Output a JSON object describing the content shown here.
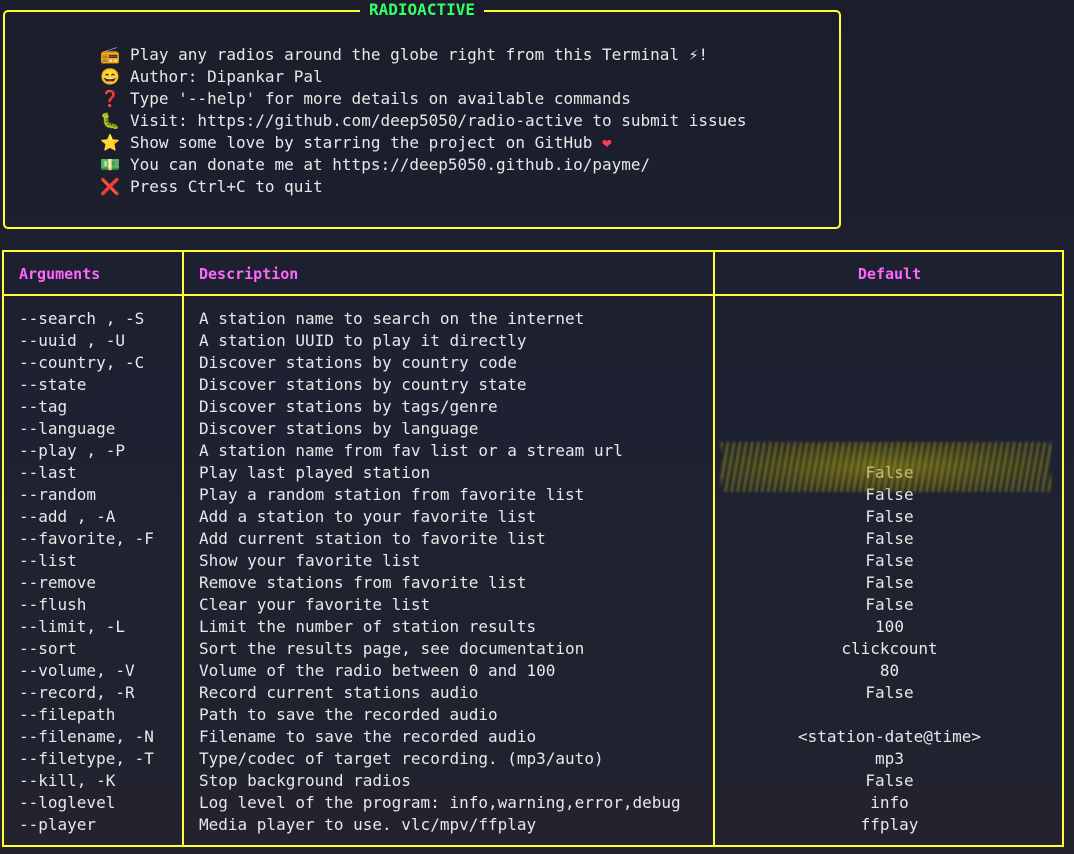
{
  "banner": {
    "title": "RADIOACTIVE",
    "lines": [
      {
        "icon": "📻",
        "icon_name": "radio-icon",
        "text": "Play any radios around the globe right from this Terminal ",
        "suffix": "⚡!"
      },
      {
        "icon": "😄",
        "icon_name": "smile-icon",
        "text": "Author: Dipankar Pal",
        "suffix": ""
      },
      {
        "icon": "❓",
        "icon_name": "question-icon",
        "text": "Type '--help' for more details on available commands",
        "suffix": ""
      },
      {
        "icon": "🐛",
        "icon_name": "bug-icon",
        "text": "Visit: https://github.com/deep5050/radio-active to submit issues",
        "suffix": ""
      },
      {
        "icon": "⭐",
        "icon_name": "star-icon",
        "text": "Show some love by starring the project on GitHub ",
        "suffix": "❤"
      },
      {
        "icon": "💵",
        "icon_name": "money-icon",
        "text": "You can donate me at https://deep5050.github.io/payme/",
        "suffix": ""
      },
      {
        "icon": "❌",
        "icon_name": "cross-icon",
        "text": "Press Ctrl+C to quit",
        "suffix": ""
      }
    ]
  },
  "table": {
    "headers": {
      "arguments": "Arguments",
      "description": "Description",
      "default": "Default"
    },
    "rows": [
      {
        "arg": "--search , -S",
        "desc": "A station name to search on the internet",
        "default": ""
      },
      {
        "arg": "--uuid , -U",
        "desc": "A station UUID to play it directly",
        "default": ""
      },
      {
        "arg": "--country, -C",
        "desc": "Discover stations by country code",
        "default": ""
      },
      {
        "arg": "--state",
        "desc": "Discover stations by country state",
        "default": ""
      },
      {
        "arg": "--tag",
        "desc": "Discover stations by tags/genre",
        "default": ""
      },
      {
        "arg": "--language",
        "desc": "Discover stations by language",
        "default": ""
      },
      {
        "arg": "--play , -P",
        "desc": "A station name from fav list or a stream url",
        "default": ""
      },
      {
        "arg": "--last",
        "desc": "Play last played station",
        "default": "False"
      },
      {
        "arg": "--random",
        "desc": "Play a random station from favorite list",
        "default": "False"
      },
      {
        "arg": "--add , -A",
        "desc": "Add a station to your favorite list",
        "default": "False"
      },
      {
        "arg": "--favorite, -F",
        "desc": "Add current station to favorite list",
        "default": "False"
      },
      {
        "arg": "--list",
        "desc": "Show your favorite list",
        "default": "False"
      },
      {
        "arg": "--remove",
        "desc": "Remove stations from favorite list",
        "default": "False"
      },
      {
        "arg": "--flush",
        "desc": "Clear your favorite list",
        "default": "False"
      },
      {
        "arg": "--limit, -L",
        "desc": "Limit the number of station results",
        "default": "100"
      },
      {
        "arg": "--sort",
        "desc": "Sort the results page, see documentation",
        "default": "clickcount"
      },
      {
        "arg": "--volume, -V",
        "desc": "Volume of the radio between 0 and 100",
        "default": "80"
      },
      {
        "arg": "--record, -R",
        "desc": "Record current stations audio",
        "default": "False"
      },
      {
        "arg": "--filepath",
        "desc": "Path to save the recorded audio",
        "default": ""
      },
      {
        "arg": "--filename, -N",
        "desc": "Filename to save the recorded audio",
        "default": "<station-date@time>"
      },
      {
        "arg": "--filetype, -T",
        "desc": "Type/codec of target recording. (mp3/auto)",
        "default": "mp3"
      },
      {
        "arg": "--kill, -K",
        "desc": "Stop background radios",
        "default": "False"
      },
      {
        "arg": "--loglevel",
        "desc": "Log level of the program: info,warning,error,debug",
        "default": "info"
      },
      {
        "arg": "--player",
        "desc": "Media player to use. vlc/mpv/ffplay",
        "default": "ffplay"
      }
    ]
  },
  "colors": {
    "border": "#ffff33",
    "title": "#33ff66",
    "header": "#ff66ff",
    "text": "#e8e8e8"
  }
}
